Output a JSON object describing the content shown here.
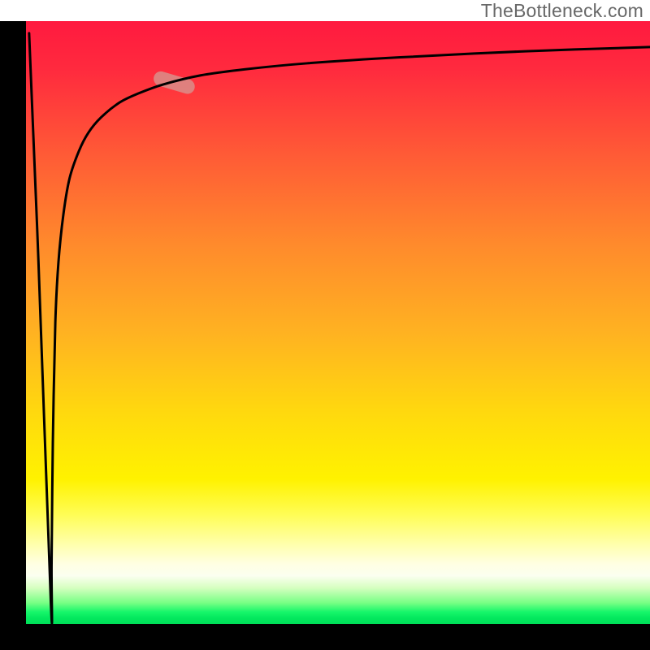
{
  "watermark": "TheBottleneck.com",
  "chart_data": {
    "type": "line",
    "title": "",
    "xlabel": "",
    "ylabel": "",
    "xlim": [
      0,
      100
    ],
    "ylim": [
      0,
      100
    ],
    "grid": false,
    "legend": false,
    "background_gradient": {
      "orientation": "vertical",
      "stops": [
        {
          "pos": 0.0,
          "color": "#ff1a3f"
        },
        {
          "pos": 0.5,
          "color": "#ffb321"
        },
        {
          "pos": 0.78,
          "color": "#fff200"
        },
        {
          "pos": 0.9,
          "color": "#ffffe0"
        },
        {
          "pos": 0.97,
          "color": "#77ff84"
        },
        {
          "pos": 1.0,
          "color": "#00e058"
        }
      ]
    },
    "series": [
      {
        "name": "curve",
        "stroke": "#000000",
        "x": [
          0.5,
          2.0,
          4.0,
          4.1,
          4.3,
          4.7,
          5.2,
          6.0,
          7.0,
          8.5,
          10.0,
          12.0,
          15.0,
          18.0,
          22.0,
          28.0,
          35.0,
          45.0,
          60.0,
          80.0,
          100.0
        ],
        "y": [
          98.0,
          60.0,
          3.0,
          10.0,
          30.0,
          50.0,
          60.0,
          68.0,
          74.0,
          78.5,
          81.5,
          84.0,
          86.5,
          88.0,
          89.5,
          91.0,
          92.0,
          93.0,
          94.0,
          95.0,
          95.7
        ]
      }
    ],
    "markers": [
      {
        "name": "highlight-segment",
        "shape": "pill",
        "color": "#d98e8a",
        "opacity": 0.85,
        "x_range": [
          20.5,
          27.0
        ],
        "y_range": [
          88.8,
          90.8
        ]
      }
    ]
  }
}
